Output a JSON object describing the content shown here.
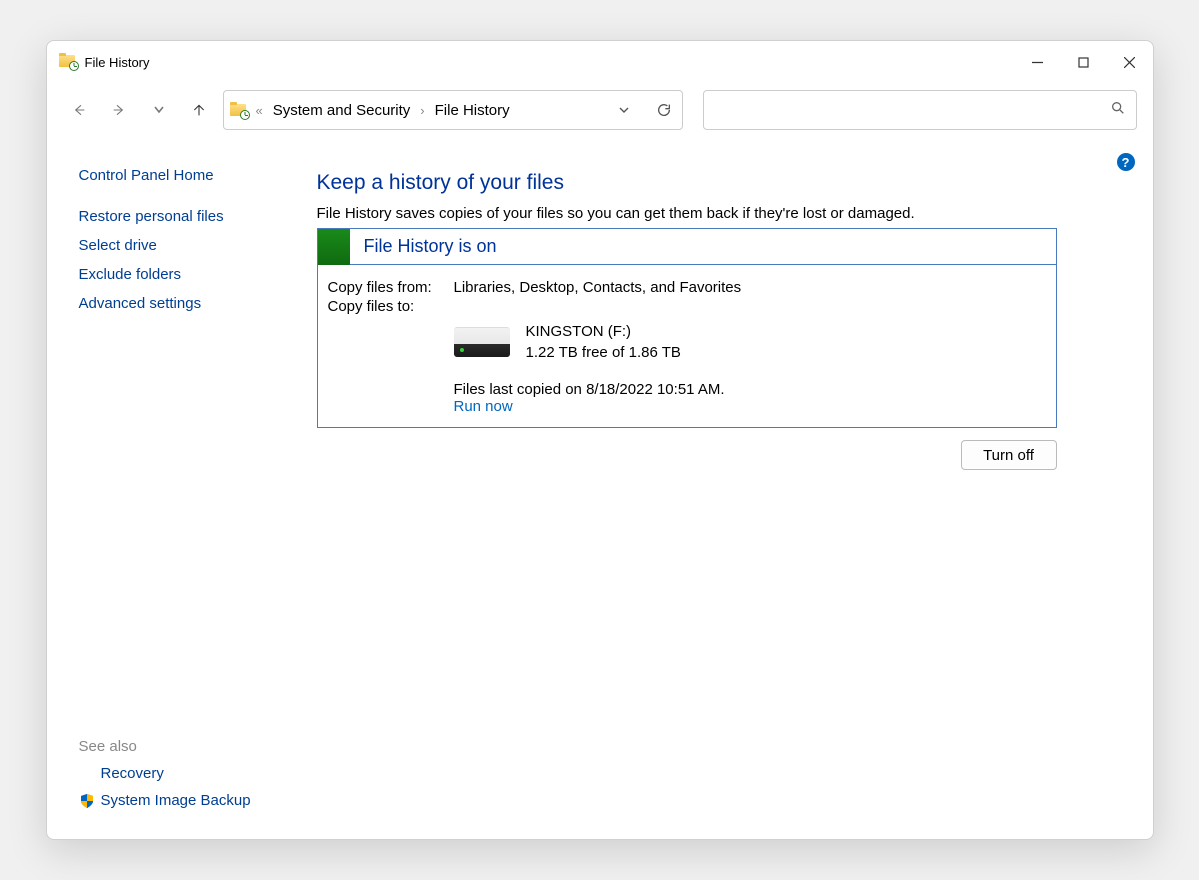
{
  "window": {
    "title": "File History"
  },
  "breadcrumb": {
    "parent": "System and Security",
    "current": "File History"
  },
  "sidebar": {
    "home": "Control Panel Home",
    "links": [
      {
        "label": "Restore personal files"
      },
      {
        "label": "Select drive"
      },
      {
        "label": "Exclude folders"
      },
      {
        "label": "Advanced settings"
      }
    ],
    "see_also_label": "See also",
    "see_also": [
      {
        "label": "Recovery",
        "shield": false
      },
      {
        "label": "System Image Backup",
        "shield": true
      }
    ]
  },
  "main": {
    "heading": "Keep a history of your files",
    "description": "File History saves copies of your files so you can get them back if they're lost or damaged.",
    "status_title": "File History is on",
    "copy_from_label": "Copy files from:",
    "copy_from_value": "Libraries, Desktop, Contacts, and Favorites",
    "copy_to_label": "Copy files to:",
    "drive_name": "KINGSTON (F:)",
    "drive_free": "1.22 TB free of 1.86 TB",
    "last_copied": "Files last copied on 8/18/2022 10:51 AM.",
    "run_now": "Run now",
    "turn_off": "Turn off"
  },
  "help_icon": "?"
}
